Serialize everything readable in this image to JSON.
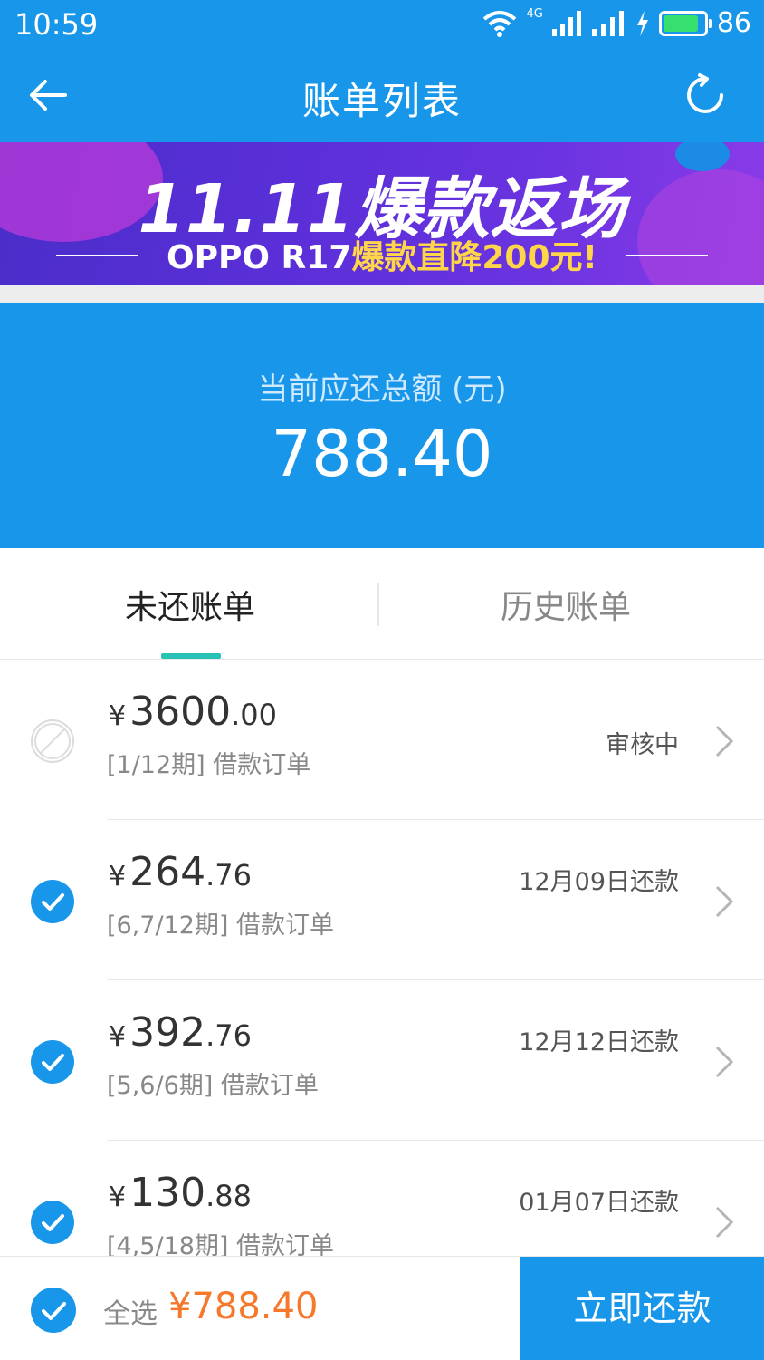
{
  "status_bar": {
    "time": "10:59",
    "network": "4G",
    "battery": "86",
    "battery_level": 0.86
  },
  "nav": {
    "title": "账单列表"
  },
  "banner": {
    "headline": "11.11爆款返场",
    "sub_white": "OPPO R17",
    "sub_yellow": "爆款直降200元",
    "sub_end": "!"
  },
  "summary": {
    "label": "当前应还总额 (元)",
    "amount": "788.40"
  },
  "tabs": [
    {
      "label": "未还账单",
      "active": true
    },
    {
      "label": "历史账单",
      "active": false
    }
  ],
  "bills": [
    {
      "checked": false,
      "disabled": true,
      "yen": "¥",
      "amount_int": "3600",
      "amount_dec": ".00",
      "desc": "[1/12期] 借款订单",
      "status": "审核中"
    },
    {
      "checked": true,
      "disabled": false,
      "yen": "¥",
      "amount_int": "264",
      "amount_dec": ".76",
      "desc": "[6,7/12期] 借款订单",
      "status": "12月09日还款"
    },
    {
      "checked": true,
      "disabled": false,
      "yen": "¥",
      "amount_int": "392",
      "amount_dec": ".76",
      "desc": "[5,6/6期] 借款订单",
      "status": "12月12日还款"
    },
    {
      "checked": true,
      "disabled": false,
      "yen": "¥",
      "amount_int": "130",
      "amount_dec": ".88",
      "desc": "[4,5/18期] 借款订单",
      "status": "01月07日还款"
    }
  ],
  "footer": {
    "select_all": "全选",
    "total": "¥788.40",
    "pay_button": "立即还款"
  },
  "colors": {
    "primary": "#1897ea",
    "accent_orange": "#f5782b",
    "tab_indicator": "#28c2b4"
  }
}
